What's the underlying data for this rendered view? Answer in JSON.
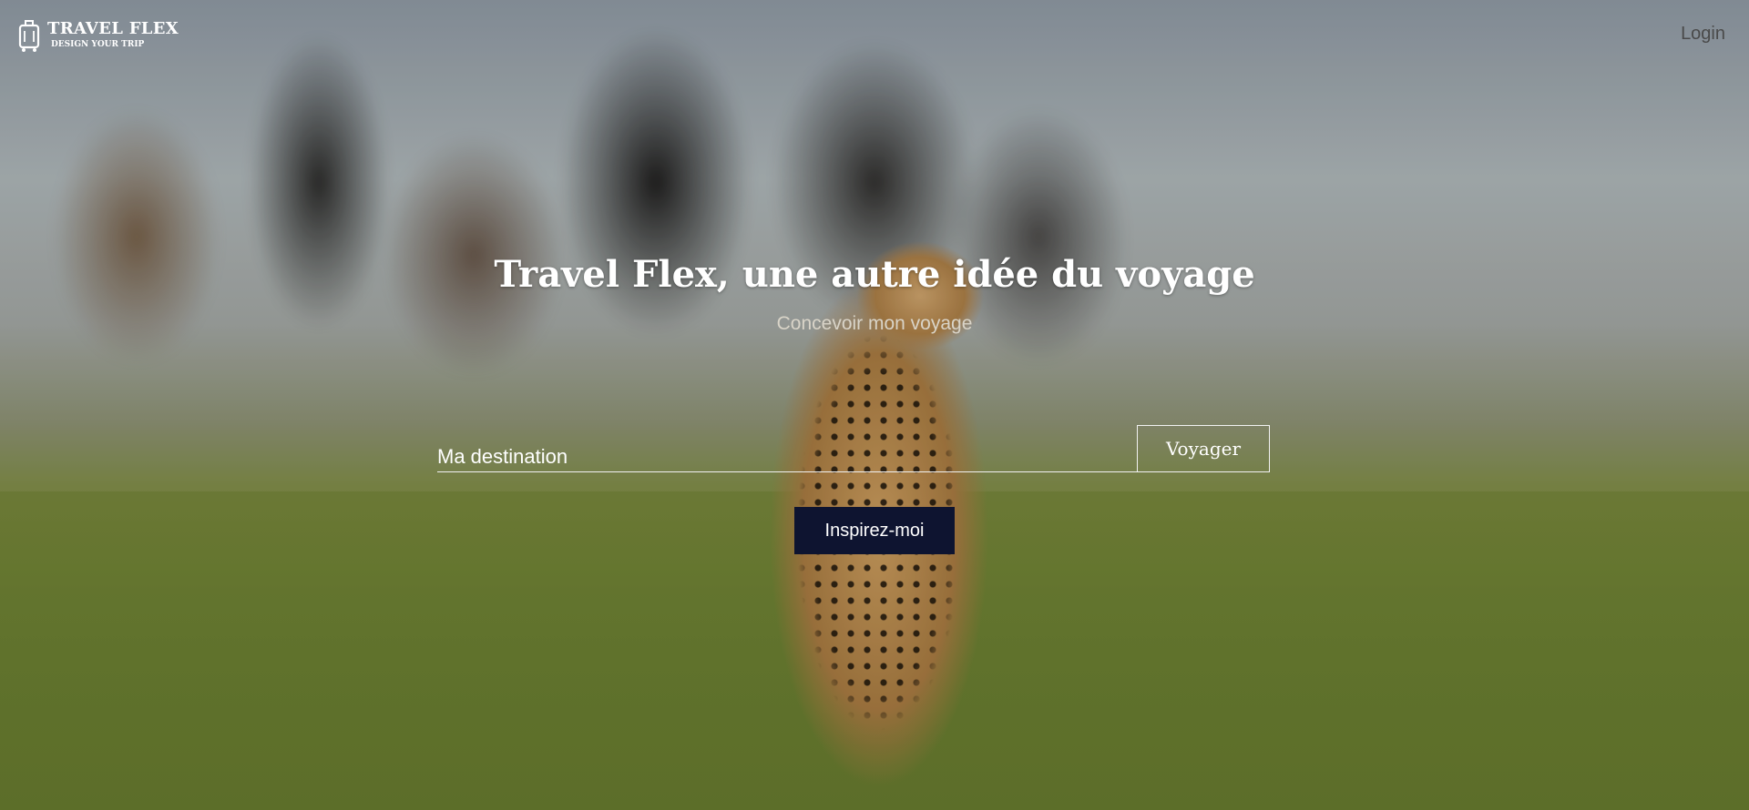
{
  "header": {
    "logo_title": "TRAVEL FLEX",
    "logo_tagline": "DESIGN YOUR TRIP",
    "login_label": "Login"
  },
  "hero": {
    "title": "Travel Flex, une autre idée du voyage",
    "subtitle": "Concevoir mon voyage",
    "background": "cheetah-in-savanna-photo"
  },
  "search": {
    "placeholder": "Ma destination",
    "value": "",
    "submit_label": "Voyager"
  },
  "inspire": {
    "label": "Inspirez-moi"
  },
  "colors": {
    "inspire_button_bg": "#0e1430",
    "text_light": "#ffffff",
    "login_text": "#4a4a4a"
  }
}
